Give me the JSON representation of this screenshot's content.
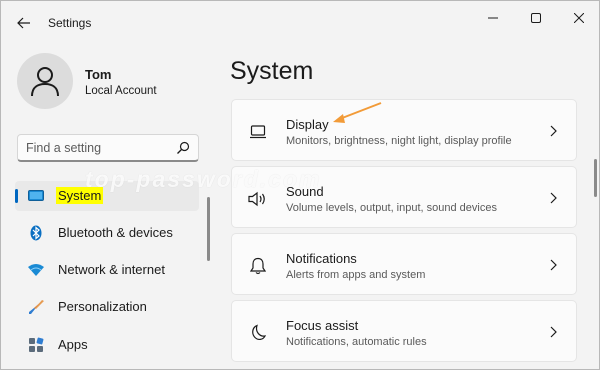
{
  "window": {
    "title": "Settings",
    "controls": {
      "minimize": "minimize",
      "maximize": "maximize",
      "close": "close"
    }
  },
  "profile": {
    "name": "Tom",
    "account_type": "Local Account"
  },
  "search": {
    "placeholder": "Find a setting",
    "value": ""
  },
  "sidebar": {
    "items": [
      {
        "label": "System",
        "icon": "monitor-icon",
        "selected": true
      },
      {
        "label": "Bluetooth & devices",
        "icon": "bluetooth-icon"
      },
      {
        "label": "Network & internet",
        "icon": "wifi-icon"
      },
      {
        "label": "Personalization",
        "icon": "brush-icon"
      },
      {
        "label": "Apps",
        "icon": "apps-icon"
      }
    ]
  },
  "main": {
    "title": "System",
    "cards": [
      {
        "title": "Display",
        "description": "Monitors, brightness, night light, display profile",
        "icon": "display-icon"
      },
      {
        "title": "Sound",
        "description": "Volume levels, output, input, sound devices",
        "icon": "speaker-icon"
      },
      {
        "title": "Notifications",
        "description": "Alerts from apps and system",
        "icon": "bell-icon"
      },
      {
        "title": "Focus assist",
        "description": "Notifications, automatic rules",
        "icon": "moon-icon"
      }
    ]
  },
  "watermark": "top-password.com",
  "colors": {
    "accent": "#0067c0",
    "highlight": "#ffff00",
    "annotation_arrow": "#f29b38"
  }
}
